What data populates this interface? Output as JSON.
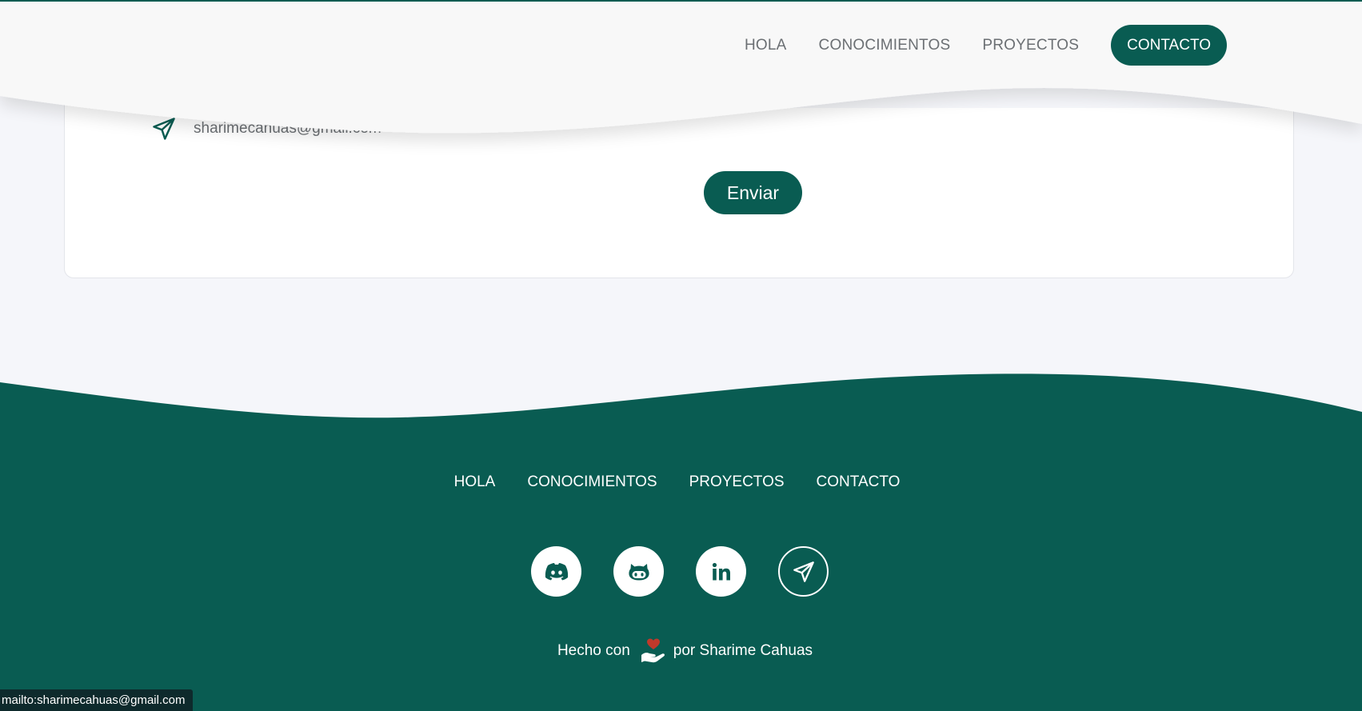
{
  "header": {
    "nav": [
      "HOLA",
      "CONOCIMIENTOS",
      "PROYECTOS"
    ],
    "cta": "CONTACTO"
  },
  "contact": {
    "email": "sharimecahuas@gmail.com",
    "send_label": "Enviar"
  },
  "footer": {
    "nav": [
      "HOLA",
      "CONOCIMIENTOS",
      "PROYECTOS",
      "CONTACTO"
    ],
    "social": [
      "discord-icon",
      "github-icon",
      "linkedin-icon",
      "send-icon"
    ],
    "credit_prefix": "Hecho con",
    "credit_suffix": "por Sharime Cahuas"
  },
  "status_bar": {
    "url": "mailto:sharimecahuas@gmail.com"
  },
  "colors": {
    "brand": "#095c52",
    "header_bg": "#f8f8f8",
    "page_bg": "#f5f6fa"
  }
}
